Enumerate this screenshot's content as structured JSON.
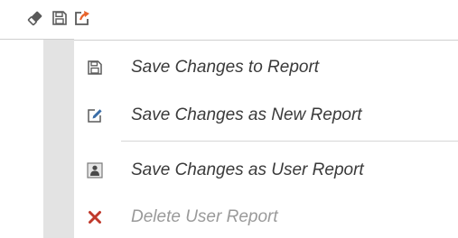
{
  "toolbar": {
    "icons": [
      {
        "name": "eraser-icon",
        "interactable": true
      },
      {
        "name": "save-icon",
        "interactable": true
      },
      {
        "name": "export-icon",
        "interactable": true
      }
    ]
  },
  "menu": {
    "items": [
      {
        "label": "Save Changes to Report",
        "icon": "save-icon",
        "enabled": true
      },
      {
        "label": "Save Changes as New Report",
        "icon": "edit-icon",
        "enabled": true
      },
      {
        "label": "Save Changes as User Report",
        "icon": "user-icon",
        "enabled": true
      },
      {
        "label": "Delete User Report",
        "icon": "delete-icon",
        "enabled": false
      }
    ]
  },
  "colors": {
    "delete_icon": "#c0392b",
    "export_arrow": "#e8632b",
    "icon_gray": "#5a5a5a",
    "edit_blue": "#3b6ea8",
    "disabled_text": "#9a9a9a"
  }
}
